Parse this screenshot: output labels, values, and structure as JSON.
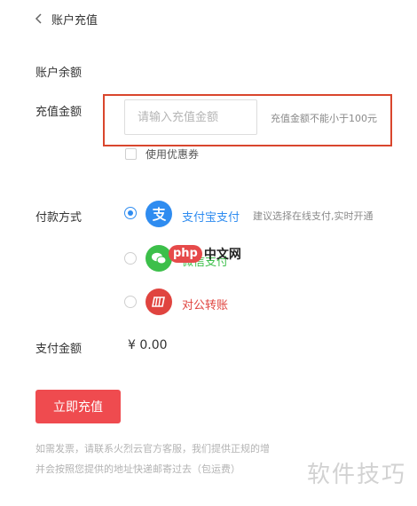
{
  "header": {
    "title": "账户充值"
  },
  "balance": {
    "label": "账户余额"
  },
  "recharge": {
    "label": "充值金额",
    "placeholder": "请输入充值金额",
    "hint": "充值金额不能小于100元"
  },
  "coupon": {
    "label": "使用优惠券",
    "checked": false
  },
  "payment": {
    "label": "付款方式",
    "methods": [
      {
        "name": "支付宝支付",
        "desc": "建议选择在线支付,实时开通",
        "selected": true,
        "color": "#2f8cf0",
        "icon": "alipay-icon"
      },
      {
        "name": "微信支付",
        "selected": false,
        "color": "#3cbf4a",
        "icon": "wechat-icon"
      },
      {
        "name": "对公转账",
        "selected": false,
        "color": "#e0443f",
        "icon": "bank-transfer-icon"
      }
    ]
  },
  "overlay_logo": {
    "part1": "php",
    "part2": "中文网"
  },
  "total": {
    "label": "支付金额",
    "value": "¥ 0.00"
  },
  "submit": {
    "label": "立即充值"
  },
  "notes": {
    "line1": "如需发票，请联系火烈云官方客服，我们提供正规的增",
    "line2": "并会按照您提供的地址快递邮寄过去（包运费）"
  },
  "watermark": {
    "text": "软件技巧"
  },
  "colors": {
    "accent_red": "#ef4b4f",
    "highlight": "#d9462d",
    "alipay_blue": "#2f8cf0",
    "wechat_green": "#3cbf4a"
  }
}
